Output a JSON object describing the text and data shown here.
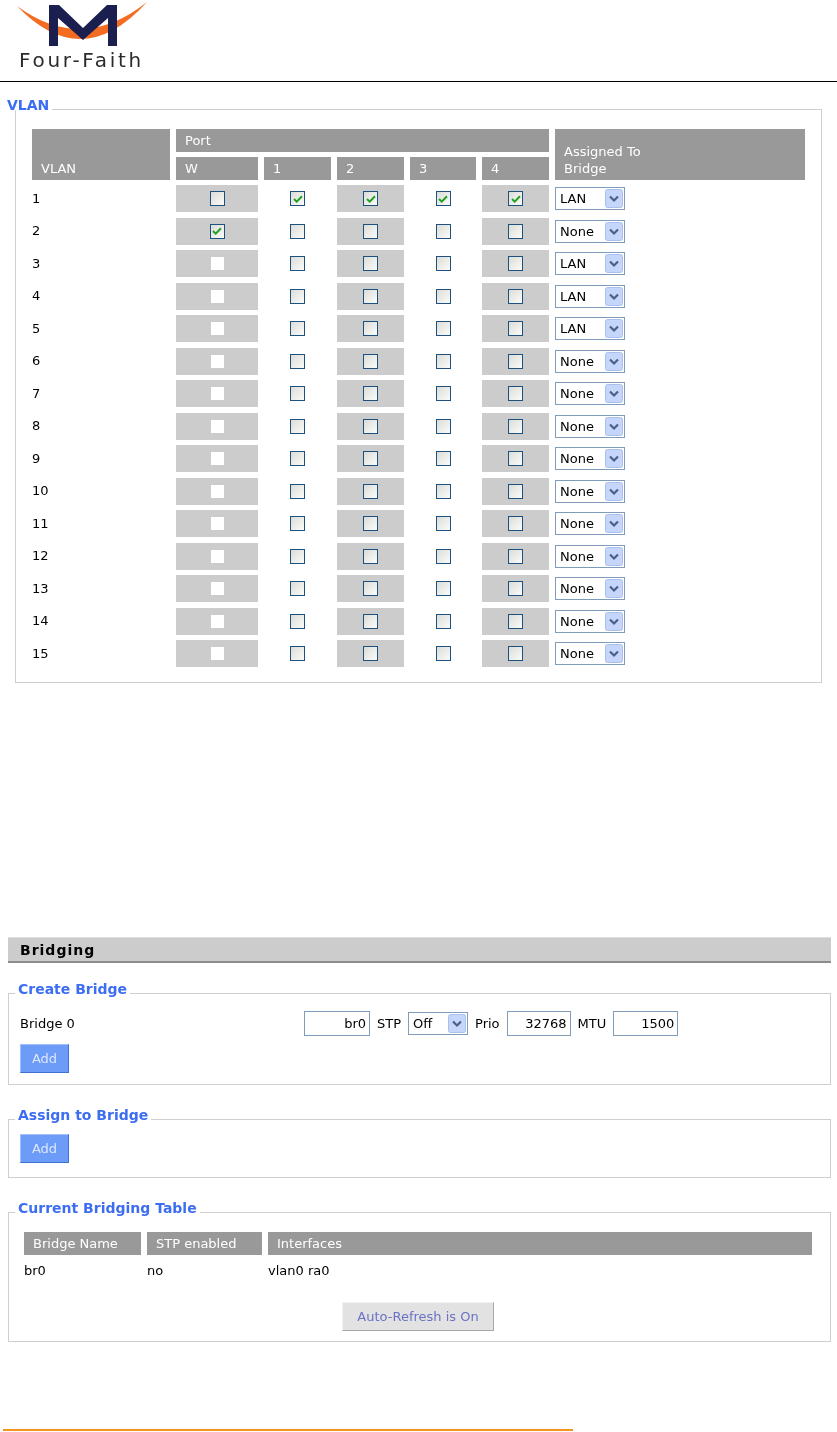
{
  "logo": {
    "text": "Four-Faith"
  },
  "vlan": {
    "legend": "VLAN",
    "columns": {
      "vlan": "VLAN",
      "port_group": "Port",
      "ports": [
        "W",
        "1",
        "2",
        "3",
        "4"
      ],
      "bridge": "Assigned To Bridge"
    },
    "rows": [
      {
        "id": "1",
        "ports": [
          {
            "checked": false,
            "disabled": false
          },
          {
            "checked": true,
            "disabled": false
          },
          {
            "checked": true,
            "disabled": false
          },
          {
            "checked": true,
            "disabled": false
          },
          {
            "checked": true,
            "disabled": false
          }
        ],
        "bridge": "LAN"
      },
      {
        "id": "2",
        "ports": [
          {
            "checked": true,
            "disabled": false
          },
          {
            "checked": false,
            "disabled": false
          },
          {
            "checked": false,
            "disabled": false
          },
          {
            "checked": false,
            "disabled": false
          },
          {
            "checked": false,
            "disabled": false
          }
        ],
        "bridge": "None"
      },
      {
        "id": "3",
        "ports": [
          {
            "checked": false,
            "disabled": true
          },
          {
            "checked": false,
            "disabled": false
          },
          {
            "checked": false,
            "disabled": false
          },
          {
            "checked": false,
            "disabled": false
          },
          {
            "checked": false,
            "disabled": false
          }
        ],
        "bridge": "LAN"
      },
      {
        "id": "4",
        "ports": [
          {
            "checked": false,
            "disabled": true
          },
          {
            "checked": false,
            "disabled": false
          },
          {
            "checked": false,
            "disabled": false
          },
          {
            "checked": false,
            "disabled": false
          },
          {
            "checked": false,
            "disabled": false
          }
        ],
        "bridge": "LAN"
      },
      {
        "id": "5",
        "ports": [
          {
            "checked": false,
            "disabled": true
          },
          {
            "checked": false,
            "disabled": false
          },
          {
            "checked": false,
            "disabled": false
          },
          {
            "checked": false,
            "disabled": false
          },
          {
            "checked": false,
            "disabled": false
          }
        ],
        "bridge": "LAN"
      },
      {
        "id": "6",
        "ports": [
          {
            "checked": false,
            "disabled": true
          },
          {
            "checked": false,
            "disabled": false
          },
          {
            "checked": false,
            "disabled": false
          },
          {
            "checked": false,
            "disabled": false
          },
          {
            "checked": false,
            "disabled": false
          }
        ],
        "bridge": "None"
      },
      {
        "id": "7",
        "ports": [
          {
            "checked": false,
            "disabled": true
          },
          {
            "checked": false,
            "disabled": false
          },
          {
            "checked": false,
            "disabled": false
          },
          {
            "checked": false,
            "disabled": false
          },
          {
            "checked": false,
            "disabled": false
          }
        ],
        "bridge": "None"
      },
      {
        "id": "8",
        "ports": [
          {
            "checked": false,
            "disabled": true
          },
          {
            "checked": false,
            "disabled": false
          },
          {
            "checked": false,
            "disabled": false
          },
          {
            "checked": false,
            "disabled": false
          },
          {
            "checked": false,
            "disabled": false
          }
        ],
        "bridge": "None"
      },
      {
        "id": "9",
        "ports": [
          {
            "checked": false,
            "disabled": true
          },
          {
            "checked": false,
            "disabled": false
          },
          {
            "checked": false,
            "disabled": false
          },
          {
            "checked": false,
            "disabled": false
          },
          {
            "checked": false,
            "disabled": false
          }
        ],
        "bridge": "None"
      },
      {
        "id": "10",
        "ports": [
          {
            "checked": false,
            "disabled": true
          },
          {
            "checked": false,
            "disabled": false
          },
          {
            "checked": false,
            "disabled": false
          },
          {
            "checked": false,
            "disabled": false
          },
          {
            "checked": false,
            "disabled": false
          }
        ],
        "bridge": "None"
      },
      {
        "id": "11",
        "ports": [
          {
            "checked": false,
            "disabled": true
          },
          {
            "checked": false,
            "disabled": false
          },
          {
            "checked": false,
            "disabled": false
          },
          {
            "checked": false,
            "disabled": false
          },
          {
            "checked": false,
            "disabled": false
          }
        ],
        "bridge": "None"
      },
      {
        "id": "12",
        "ports": [
          {
            "checked": false,
            "disabled": true
          },
          {
            "checked": false,
            "disabled": false
          },
          {
            "checked": false,
            "disabled": false
          },
          {
            "checked": false,
            "disabled": false
          },
          {
            "checked": false,
            "disabled": false
          }
        ],
        "bridge": "None"
      },
      {
        "id": "13",
        "ports": [
          {
            "checked": false,
            "disabled": true
          },
          {
            "checked": false,
            "disabled": false
          },
          {
            "checked": false,
            "disabled": false
          },
          {
            "checked": false,
            "disabled": false
          },
          {
            "checked": false,
            "disabled": false
          }
        ],
        "bridge": "None"
      },
      {
        "id": "14",
        "ports": [
          {
            "checked": false,
            "disabled": true
          },
          {
            "checked": false,
            "disabled": false
          },
          {
            "checked": false,
            "disabled": false
          },
          {
            "checked": false,
            "disabled": false
          },
          {
            "checked": false,
            "disabled": false
          }
        ],
        "bridge": "None"
      },
      {
        "id": "15",
        "ports": [
          {
            "checked": false,
            "disabled": true
          },
          {
            "checked": false,
            "disabled": false
          },
          {
            "checked": false,
            "disabled": false
          },
          {
            "checked": false,
            "disabled": false
          },
          {
            "checked": false,
            "disabled": false
          }
        ],
        "bridge": "None"
      }
    ]
  },
  "bridging": {
    "title": "Bridging",
    "create_bridge": {
      "legend": "Create Bridge",
      "bridges": [
        {
          "label": "Bridge 0",
          "name": "br0",
          "stp_label": "STP",
          "stp": "Off",
          "prio_label": "Prio",
          "prio": "32768",
          "mtu_label": "MTU",
          "mtu": "1500"
        }
      ],
      "add_button": "Add"
    },
    "assign_to_bridge": {
      "legend": "Assign to Bridge",
      "add_button": "Add"
    },
    "bridging_table": {
      "legend": "Current Bridging Table",
      "columns": [
        "Bridge Name",
        "STP enabled",
        "Interfaces"
      ],
      "rows": [
        [
          "br0",
          "no",
          "vlan0 ra0"
        ]
      ],
      "refresh_button": {
        "label": "Auto-Refresh is On",
        "disabled": true
      }
    }
  }
}
